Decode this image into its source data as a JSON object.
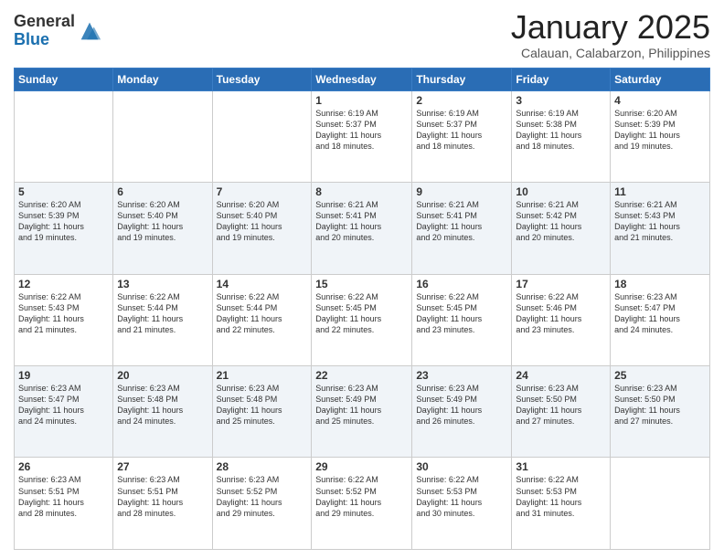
{
  "header": {
    "logo_line1": "General",
    "logo_line2": "Blue",
    "month": "January 2025",
    "location": "Calauan, Calabarzon, Philippines"
  },
  "days_of_week": [
    "Sunday",
    "Monday",
    "Tuesday",
    "Wednesday",
    "Thursday",
    "Friday",
    "Saturday"
  ],
  "weeks": [
    [
      {
        "num": "",
        "info": ""
      },
      {
        "num": "",
        "info": ""
      },
      {
        "num": "",
        "info": ""
      },
      {
        "num": "1",
        "info": "Sunrise: 6:19 AM\nSunset: 5:37 PM\nDaylight: 11 hours\nand 18 minutes."
      },
      {
        "num": "2",
        "info": "Sunrise: 6:19 AM\nSunset: 5:37 PM\nDaylight: 11 hours\nand 18 minutes."
      },
      {
        "num": "3",
        "info": "Sunrise: 6:19 AM\nSunset: 5:38 PM\nDaylight: 11 hours\nand 18 minutes."
      },
      {
        "num": "4",
        "info": "Sunrise: 6:20 AM\nSunset: 5:39 PM\nDaylight: 11 hours\nand 19 minutes."
      }
    ],
    [
      {
        "num": "5",
        "info": "Sunrise: 6:20 AM\nSunset: 5:39 PM\nDaylight: 11 hours\nand 19 minutes."
      },
      {
        "num": "6",
        "info": "Sunrise: 6:20 AM\nSunset: 5:40 PM\nDaylight: 11 hours\nand 19 minutes."
      },
      {
        "num": "7",
        "info": "Sunrise: 6:20 AM\nSunset: 5:40 PM\nDaylight: 11 hours\nand 19 minutes."
      },
      {
        "num": "8",
        "info": "Sunrise: 6:21 AM\nSunset: 5:41 PM\nDaylight: 11 hours\nand 20 minutes."
      },
      {
        "num": "9",
        "info": "Sunrise: 6:21 AM\nSunset: 5:41 PM\nDaylight: 11 hours\nand 20 minutes."
      },
      {
        "num": "10",
        "info": "Sunrise: 6:21 AM\nSunset: 5:42 PM\nDaylight: 11 hours\nand 20 minutes."
      },
      {
        "num": "11",
        "info": "Sunrise: 6:21 AM\nSunset: 5:43 PM\nDaylight: 11 hours\nand 21 minutes."
      }
    ],
    [
      {
        "num": "12",
        "info": "Sunrise: 6:22 AM\nSunset: 5:43 PM\nDaylight: 11 hours\nand 21 minutes."
      },
      {
        "num": "13",
        "info": "Sunrise: 6:22 AM\nSunset: 5:44 PM\nDaylight: 11 hours\nand 21 minutes."
      },
      {
        "num": "14",
        "info": "Sunrise: 6:22 AM\nSunset: 5:44 PM\nDaylight: 11 hours\nand 22 minutes."
      },
      {
        "num": "15",
        "info": "Sunrise: 6:22 AM\nSunset: 5:45 PM\nDaylight: 11 hours\nand 22 minutes."
      },
      {
        "num": "16",
        "info": "Sunrise: 6:22 AM\nSunset: 5:45 PM\nDaylight: 11 hours\nand 23 minutes."
      },
      {
        "num": "17",
        "info": "Sunrise: 6:22 AM\nSunset: 5:46 PM\nDaylight: 11 hours\nand 23 minutes."
      },
      {
        "num": "18",
        "info": "Sunrise: 6:23 AM\nSunset: 5:47 PM\nDaylight: 11 hours\nand 24 minutes."
      }
    ],
    [
      {
        "num": "19",
        "info": "Sunrise: 6:23 AM\nSunset: 5:47 PM\nDaylight: 11 hours\nand 24 minutes."
      },
      {
        "num": "20",
        "info": "Sunrise: 6:23 AM\nSunset: 5:48 PM\nDaylight: 11 hours\nand 24 minutes."
      },
      {
        "num": "21",
        "info": "Sunrise: 6:23 AM\nSunset: 5:48 PM\nDaylight: 11 hours\nand 25 minutes."
      },
      {
        "num": "22",
        "info": "Sunrise: 6:23 AM\nSunset: 5:49 PM\nDaylight: 11 hours\nand 25 minutes."
      },
      {
        "num": "23",
        "info": "Sunrise: 6:23 AM\nSunset: 5:49 PM\nDaylight: 11 hours\nand 26 minutes."
      },
      {
        "num": "24",
        "info": "Sunrise: 6:23 AM\nSunset: 5:50 PM\nDaylight: 11 hours\nand 27 minutes."
      },
      {
        "num": "25",
        "info": "Sunrise: 6:23 AM\nSunset: 5:50 PM\nDaylight: 11 hours\nand 27 minutes."
      }
    ],
    [
      {
        "num": "26",
        "info": "Sunrise: 6:23 AM\nSunset: 5:51 PM\nDaylight: 11 hours\nand 28 minutes."
      },
      {
        "num": "27",
        "info": "Sunrise: 6:23 AM\nSunset: 5:51 PM\nDaylight: 11 hours\nand 28 minutes."
      },
      {
        "num": "28",
        "info": "Sunrise: 6:23 AM\nSunset: 5:52 PM\nDaylight: 11 hours\nand 29 minutes."
      },
      {
        "num": "29",
        "info": "Sunrise: 6:22 AM\nSunset: 5:52 PM\nDaylight: 11 hours\nand 29 minutes."
      },
      {
        "num": "30",
        "info": "Sunrise: 6:22 AM\nSunset: 5:53 PM\nDaylight: 11 hours\nand 30 minutes."
      },
      {
        "num": "31",
        "info": "Sunrise: 6:22 AM\nSunset: 5:53 PM\nDaylight: 11 hours\nand 31 minutes."
      },
      {
        "num": "",
        "info": ""
      }
    ]
  ]
}
